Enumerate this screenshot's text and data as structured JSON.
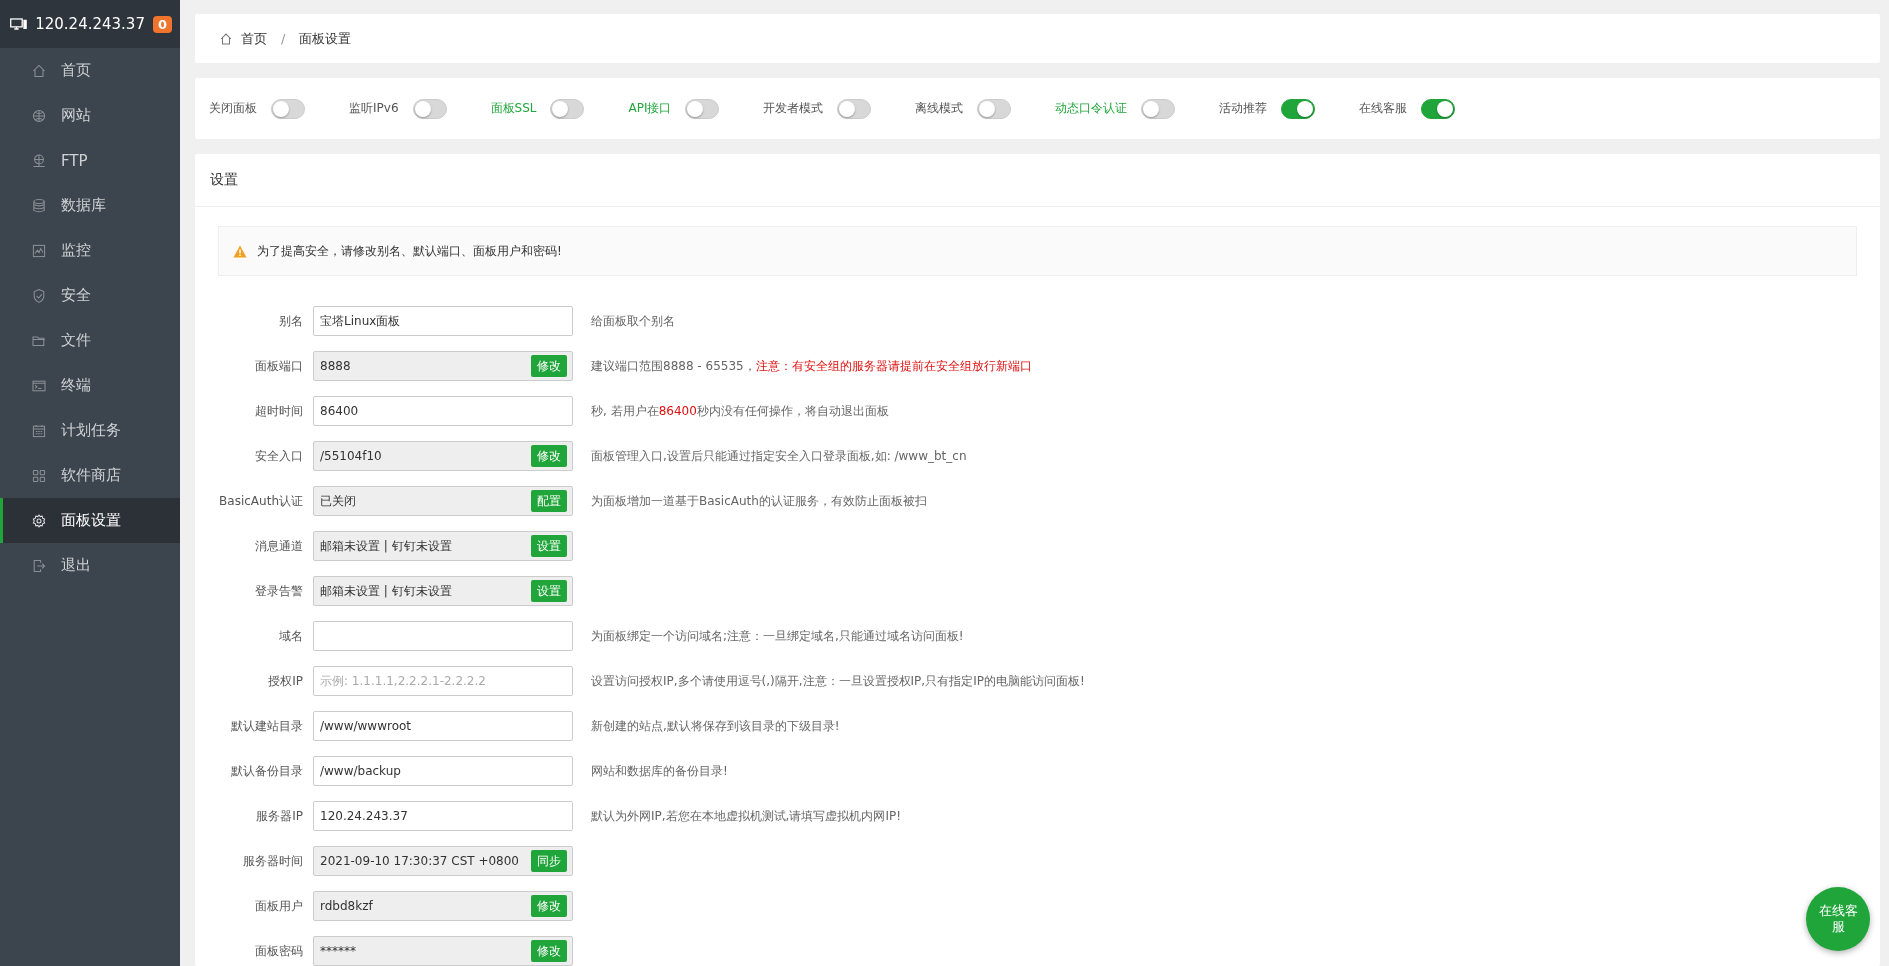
{
  "sidebar": {
    "host": "120.24.243.37",
    "badge": "0",
    "items": [
      {
        "label": "首页",
        "selected": false
      },
      {
        "label": "网站",
        "selected": false
      },
      {
        "label": "FTP",
        "selected": false
      },
      {
        "label": "数据库",
        "selected": false
      },
      {
        "label": "监控",
        "selected": false
      },
      {
        "label": "安全",
        "selected": false
      },
      {
        "label": "文件",
        "selected": false
      },
      {
        "label": "终端",
        "selected": false
      },
      {
        "label": "计划任务",
        "selected": false
      },
      {
        "label": "软件商店",
        "selected": false
      },
      {
        "label": "面板设置",
        "selected": true
      },
      {
        "label": "退出",
        "selected": false
      }
    ]
  },
  "breadcrumb": [
    "首页",
    "面板设置"
  ],
  "breadcrumb_separator": "/",
  "toggles": [
    {
      "label": "关闭面板",
      "on": false,
      "color": "#555555"
    },
    {
      "label": "监听IPv6",
      "on": false,
      "color": "#555555"
    },
    {
      "label": "面板SSL",
      "on": false,
      "color": "#20a53a"
    },
    {
      "label": "API接口",
      "on": false,
      "color": "#20a53a"
    },
    {
      "label": "开发者模式",
      "on": false,
      "color": "#555555"
    },
    {
      "label": "离线模式",
      "on": false,
      "color": "#555555"
    },
    {
      "label": "动态口令认证",
      "on": false,
      "color": "#20a53a"
    },
    {
      "label": "活动推荐",
      "on": true,
      "color": "#555555"
    },
    {
      "label": "在线客服",
      "on": true,
      "color": "#555555"
    }
  ],
  "settings": {
    "title": "设置",
    "alert": "为了提高安全，请修改别名、默认端口、面板用户和密码!",
    "rows": [
      {
        "label": "别名",
        "kind": "input",
        "value": "宝塔Linux面板",
        "description": [
          {
            "text": "给面板取个别名",
            "warning": false
          }
        ]
      },
      {
        "label": "面板端口",
        "kind": "readonly",
        "value": "8888",
        "button": "修改",
        "description": [
          {
            "text": "建议端口范围8888 - 65535，",
            "warning": false
          },
          {
            "text": "注意：有安全组的服务器请提前在安全组放行新端口",
            "warning": true
          }
        ]
      },
      {
        "label": "超时时间",
        "kind": "input",
        "value": "86400",
        "description": [
          {
            "text": "秒, 若用户在",
            "warning": false
          },
          {
            "text": "86400",
            "warning": true
          },
          {
            "text": "秒内没有任何操作，将自动退出面板",
            "warning": false
          }
        ]
      },
      {
        "label": "安全入口",
        "kind": "readonly",
        "value": "/55104f10",
        "button": "修改",
        "description": [
          {
            "text": "面板管理入口,设置后只能通过指定安全入口登录面板,如: /www_bt_cn",
            "warning": false
          }
        ]
      },
      {
        "label": "BasicAuth认证",
        "kind": "readonly",
        "value": "已关闭",
        "button": "配置",
        "description": [
          {
            "text": "为面板增加一道基于BasicAuth的认证服务，有效防止面板被扫",
            "warning": false
          }
        ]
      },
      {
        "label": "消息通道",
        "kind": "readonly",
        "value": "邮箱未设置 | 钉钉未设置",
        "button": "设置"
      },
      {
        "label": "登录告警",
        "kind": "readonly",
        "value": "邮箱未设置 | 钉钉未设置",
        "button": "设置"
      },
      {
        "label": "域名",
        "kind": "input",
        "description": [
          {
            "text": "为面板绑定一个访问域名;注意：一旦绑定域名,只能通过域名访问面板!",
            "warning": false
          }
        ]
      },
      {
        "label": "授权IP",
        "kind": "input",
        "placeholder": "示例: 1.1.1.1,2.2.2.1-2.2.2.2",
        "description": [
          {
            "text": "设置访问授权IP,多个请使用逗号(,)隔开,注意：一旦设置授权IP,只有指定IP的电脑能访问面板!",
            "warning": false
          }
        ]
      },
      {
        "label": "默认建站目录",
        "kind": "input",
        "value": "/www/wwwroot",
        "description": [
          {
            "text": "新创建的站点,默认将保存到该目录的下级目录!",
            "warning": false
          }
        ]
      },
      {
        "label": "默认备份目录",
        "kind": "input",
        "value": "/www/backup",
        "description": [
          {
            "text": "网站和数据库的备份目录!",
            "warning": false
          }
        ]
      },
      {
        "label": "服务器IP",
        "kind": "input",
        "value": "120.24.243.37",
        "description": [
          {
            "text": "默认为外网IP,若您在本地虚拟机测试,请填写虚拟机内网IP!",
            "warning": false
          }
        ]
      },
      {
        "label": "服务器时间",
        "kind": "readonly",
        "value": "2021-09-10 17:30:37 CST +0800",
        "button": "同步"
      },
      {
        "label": "面板用户",
        "kind": "readonly",
        "value": "rdbd8kzf",
        "button": "修改"
      },
      {
        "label": "面板密码",
        "kind": "readonly",
        "value": "******",
        "button": "修改"
      }
    ]
  },
  "chat_button": "在线客服"
}
